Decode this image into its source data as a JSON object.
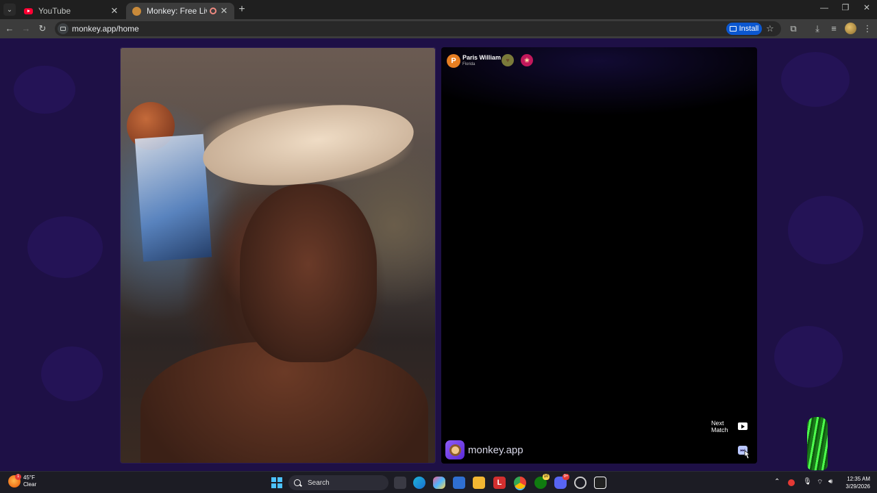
{
  "browser": {
    "tabs": [
      {
        "title": "YouTube",
        "favicon": "youtube-icon"
      },
      {
        "title": "Monkey: Free Live Video Ch",
        "favicon": "monkey-icon",
        "recording": true
      }
    ],
    "url": "monkey.app/home",
    "install_label": "Install"
  },
  "peer": {
    "initial": "P",
    "name": "Paris William",
    "location": "Florida",
    "badges": [
      "heart-icon",
      "gift-icon"
    ]
  },
  "controls": {
    "next_match_line1": "Next",
    "next_match_line2": "Match",
    "skip_glyph": "⏭"
  },
  "brand": {
    "name": "monkey.app"
  },
  "taskbar": {
    "weather_temp": "45°F",
    "weather_desc": "Clear",
    "weather_alert": "1",
    "search_label": "Search",
    "xbox_count": "10",
    "discord_count": "9+",
    "time": "12:35 AM",
    "date": "3/29/2026"
  },
  "colors": {
    "page_bg": "#1e1046",
    "accent": "#0b57d0",
    "peer_avatar": "#e67e22"
  }
}
